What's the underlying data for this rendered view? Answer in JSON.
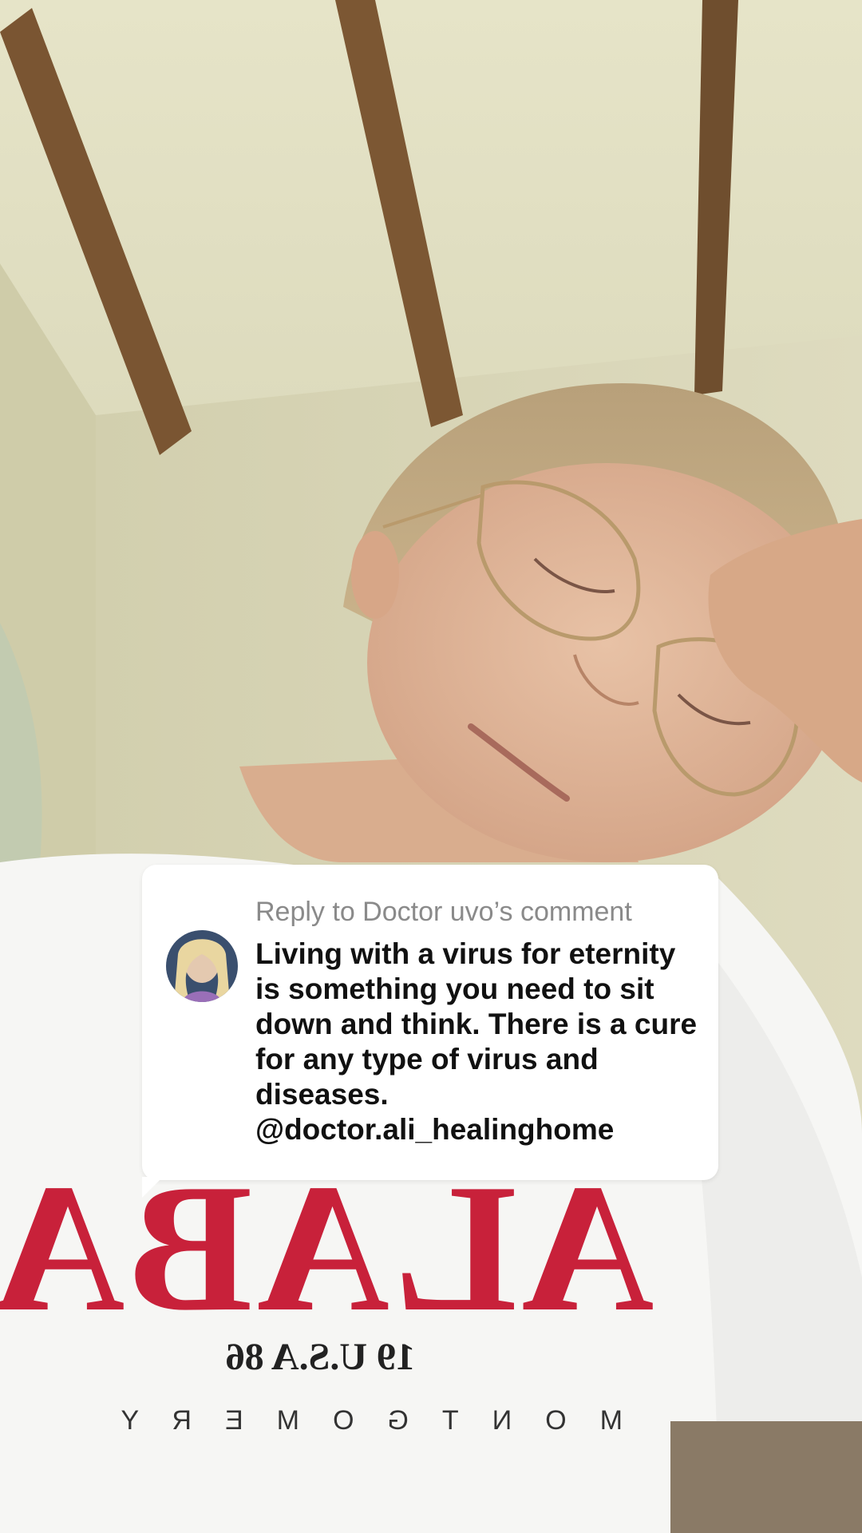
{
  "reply": {
    "header": "Reply to Doctor uvo’s comment",
    "comment_text": "Living with a virus for eternity is something you need to sit down and think. There is a cure for any type of virus and diseases. @doctor.ali_healinghome"
  },
  "shirt": {
    "word": "ALABAMA",
    "subline": "19 U.S.A 86",
    "city": "MONTGOMERY"
  },
  "colors": {
    "card_bg": "#ffffff",
    "header_text": "#8a8a8a",
    "comment_text": "#111111",
    "shirt_print": "#c8213a"
  }
}
